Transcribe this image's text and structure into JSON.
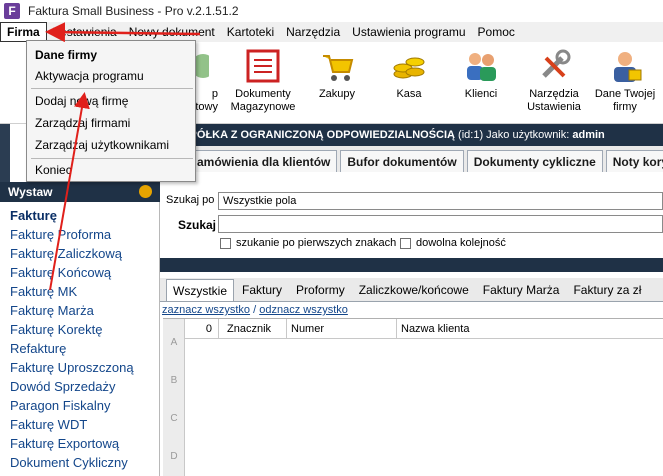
{
  "title": "Faktura Small Business - Pro v.2.1.51.2",
  "app_icon": "F",
  "menubar": [
    "Firma",
    "Zestawienia",
    "Nowy dokument",
    "Kartoteki",
    "Narzędzia",
    "Ustawienia programu",
    "Pomoc"
  ],
  "dropdown": {
    "items": [
      "Dane firmy",
      "Aktywacja programu",
      "Dodaj nową firmę",
      "Zarządzaj firmami",
      "Zarządzaj użytkownikami",
      "Koniec"
    ]
  },
  "toolbar": {
    "partial_label_1": "p",
    "partial_label_2": "towy",
    "items": [
      {
        "label": "Dokumenty Magazynowe",
        "icon": "document-register-icon"
      },
      {
        "label": "Zakupy",
        "icon": "shopping-cart-icon"
      },
      {
        "label": "Kasa",
        "icon": "coins-icon"
      },
      {
        "label": "Klienci",
        "icon": "people-icon"
      },
      {
        "label": "Narzędzia Ustawienia",
        "icon": "tools-icon"
      },
      {
        "label": "Dane Twojej firmy",
        "icon": "business-person-icon"
      }
    ]
  },
  "banner": {
    "company": "M SPÓŁKA Z OGRANICZONĄ ODPOWIEDZIALNOŚCIĄ",
    "id_text": "(id:1) Jako użytkownik:",
    "user": "admin"
  },
  "doc_tabs": [
    "amówienia dla klientów",
    "Bufor dokumentów",
    "Dokumenty cykliczne",
    "Noty korygują"
  ],
  "left_panel": {
    "header": "Wystaw",
    "items": [
      "Fakturę",
      "Fakturę Proforma",
      "Fakturę Zaliczkową",
      "Fakturę Końcową",
      "Fakturę MK",
      "Fakturę Marża",
      "Fakturę Korektę",
      "Refakturę",
      "Fakturę Uproszczoną",
      "Dowód Sprzedaży",
      "Paragon Fiskalny",
      "Fakturę WDT",
      "Fakturę Exportową",
      "Dokument Cykliczny"
    ]
  },
  "search": {
    "szukaj_po_label": "Szukaj po",
    "szukaj_po_value": "Wszystkie pola",
    "szukaj_label": "Szukaj",
    "szukaj_value": "",
    "option1": "szukanie po pierwszych znakach",
    "option2": "dowolna kolejność"
  },
  "lower_tabs": [
    "Wszystkie",
    "Faktury",
    "Proformy",
    "Zaliczkowe/końcowe",
    "Faktury Marża",
    "Faktury za zł"
  ],
  "select_links": {
    "select_all": "zaznacz wszystko",
    "sep": "/",
    "deselect_all": "odznacz wszystko"
  },
  "grid": {
    "columns": [
      "0",
      "Znacznik",
      "Numer",
      "Nazwa klienta"
    ],
    "row_headers": [
      "A",
      "B",
      "C",
      "D"
    ]
  },
  "colors": {
    "accent_dark": "#1f3146",
    "link": "#13468a",
    "arrow": "#e0201b"
  }
}
